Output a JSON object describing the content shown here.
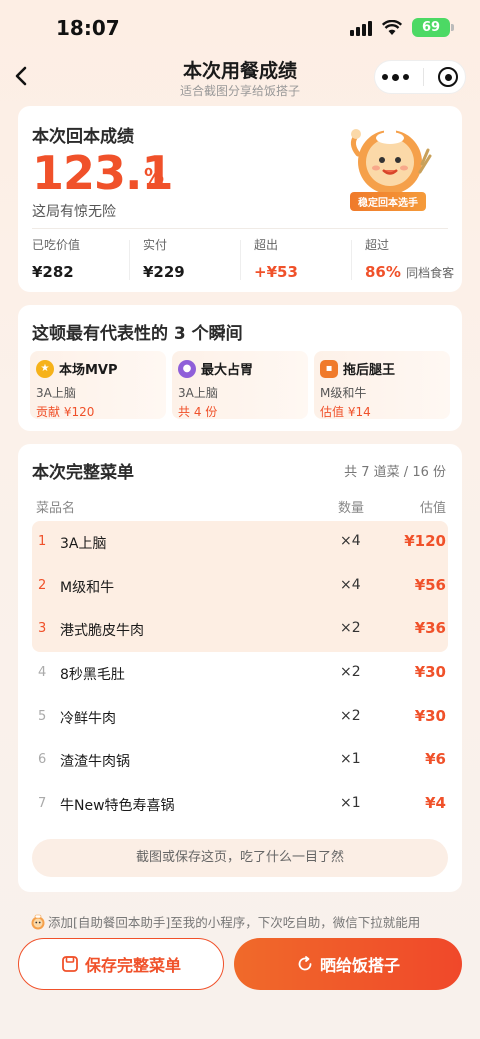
{
  "status_bar": {
    "time": "18:07",
    "battery": "69"
  },
  "nav": {
    "title": "本次用餐成绩",
    "subtitle": "适合截图分享给饭搭子"
  },
  "summary": {
    "title": "本次回本成绩",
    "ratio": "123.1",
    "percent_sign": "%",
    "verdict": "这局有惊无险",
    "badge": "稳定回本选手",
    "stats": [
      {
        "label": "已吃价值",
        "value": "¥282",
        "extra": ""
      },
      {
        "label": "实付",
        "value": "¥229",
        "extra": ""
      },
      {
        "label": "超出",
        "value": "+¥53",
        "extra": ""
      },
      {
        "label": "超过",
        "value": "86%",
        "extra": "同档食客"
      }
    ]
  },
  "moments": {
    "title": "这顿最有代表性的 3 个瞬间",
    "items": [
      {
        "title": "本场MVP",
        "item": "3A上脑",
        "value": "贡献 ¥120",
        "icon": "medal-icon",
        "color": "#f6b21a"
      },
      {
        "title": "最大占胃",
        "item": "3A上脑",
        "value": "共 4 份",
        "icon": "stomach-icon",
        "color": "#8f5fd9"
      },
      {
        "title": "拖后腿王",
        "item": "M级和牛",
        "value": "估值 ¥14",
        "icon": "drag-icon",
        "color": "#f07a2a"
      }
    ]
  },
  "menu": {
    "title": "本次完整菜单",
    "count": "共 7 道菜 / 16 份",
    "headers": {
      "name": "菜品名",
      "qty": "数量",
      "value": "估值"
    },
    "rows": [
      {
        "rank": "1",
        "name": "3A上脑",
        "qty": "×4",
        "value": "¥120"
      },
      {
        "rank": "2",
        "name": "M级和牛",
        "qty": "×4",
        "value": "¥56"
      },
      {
        "rank": "3",
        "name": "港式脆皮牛肉",
        "qty": "×2",
        "value": "¥36"
      },
      {
        "rank": "4",
        "name": "8秒黑毛肚",
        "qty": "×2",
        "value": "¥30"
      },
      {
        "rank": "5",
        "name": "冷鲜牛肉",
        "qty": "×2",
        "value": "¥30"
      },
      {
        "rank": "6",
        "name": "渣渣牛肉锅",
        "qty": "×1",
        "value": "¥6"
      },
      {
        "rank": "7",
        "name": "牛New特色寿喜锅",
        "qty": "×1",
        "value": "¥4"
      }
    ],
    "tip": "截图或保存这页，吃了什么一目了然"
  },
  "footer_note": "添加[自助餐回本助手]至我的小程序，下次吃自助，微信下拉就能用",
  "buttons": {
    "save": "保存完整菜单",
    "share": "晒给饭搭子"
  },
  "colors": {
    "accent": "#f0512a",
    "highlight_row": "#fdeee3"
  }
}
